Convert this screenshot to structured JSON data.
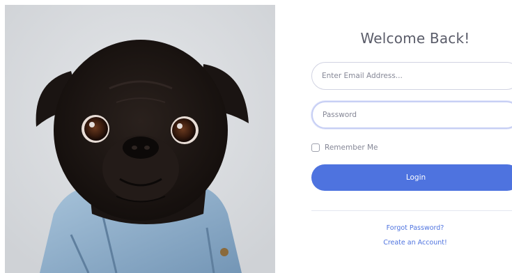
{
  "image": {
    "alt": "",
    "colors": {
      "background": "#dadcdf",
      "fur": "#1c1614",
      "jacket": "#8fb0cc"
    }
  },
  "form": {
    "title": "Welcome Back!",
    "email_placeholder": "Enter Email Address...",
    "password_placeholder": "Password",
    "remember_label": "Remember Me",
    "login_label": "Login",
    "forgot_label": "Forgot Password?",
    "create_label": "Create an Account!"
  },
  "colors": {
    "accent": "#4e73df",
    "title": "#5a5c69",
    "muted": "#858796",
    "border": "#d1d3e2",
    "focus_border": "#c7cff4"
  }
}
